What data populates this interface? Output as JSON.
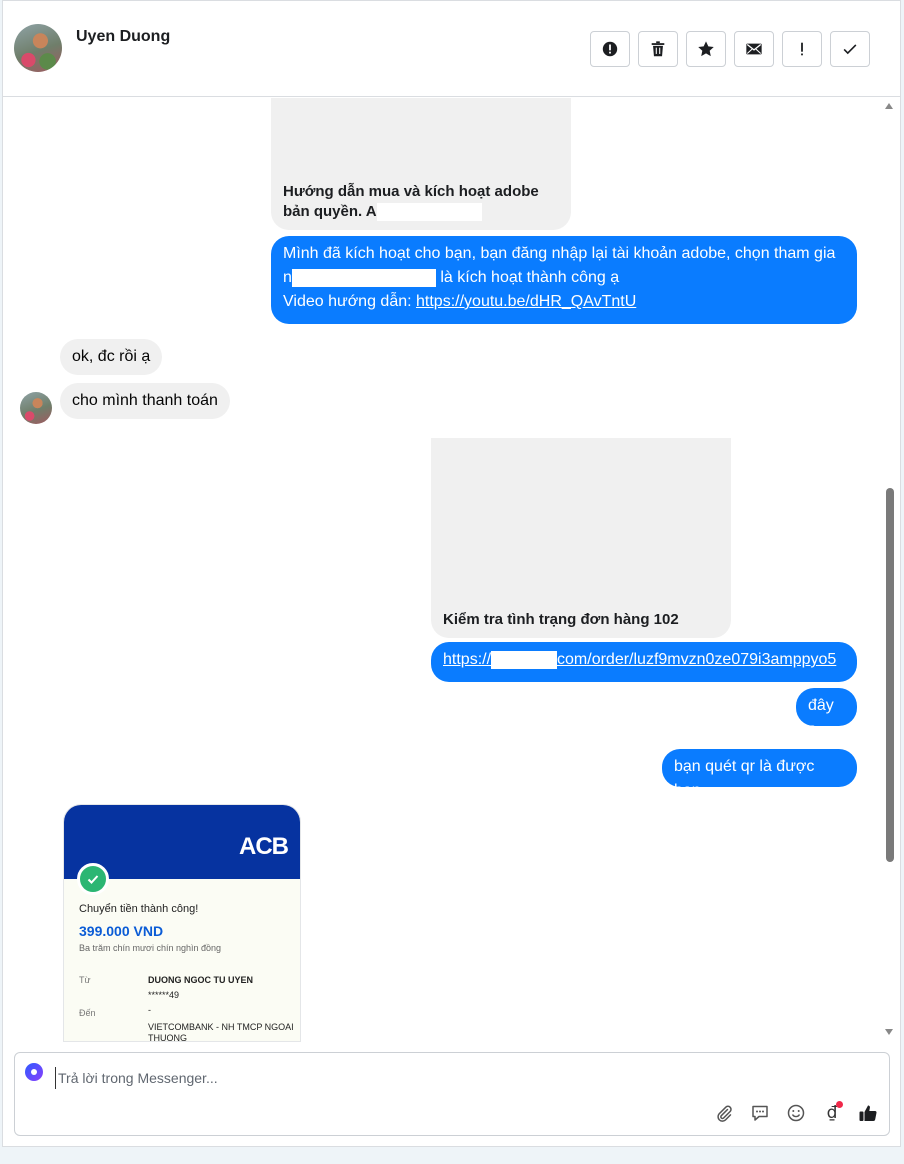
{
  "header": {
    "contact_name": "Uyen Duong",
    "actions": [
      {
        "name": "report-button",
        "icon": "alert-circle-icon"
      },
      {
        "name": "delete-button",
        "icon": "trash-icon"
      },
      {
        "name": "star-button",
        "icon": "star-icon"
      },
      {
        "name": "mark-unread-button",
        "icon": "envelope-icon"
      },
      {
        "name": "important-button",
        "icon": "exclamation-icon"
      },
      {
        "name": "done-button",
        "icon": "check-icon"
      }
    ]
  },
  "messages": {
    "card1_text_line1": "Hướng dẫn mua và kích hoạt adobe",
    "card1_text_line2": "bản quyền. A",
    "out1_line1": "Mình đã kích hoạt cho bạn, bạn đăng nhập lại tài khoản adobe, chọn tham gia",
    "out1_line2_prefix": "n",
    "out1_line2_suffix": " là kích hoạt thành công ạ",
    "out1_line3_label": "Video hướng dẫn: ",
    "out1_line3_link": "https://youtu.be/dHR_QAvTntU",
    "in1": "ok, đc rồi ạ",
    "in2": "cho mình thanh toán",
    "card2_text": "Kiểm tra tình trạng đơn hàng 102",
    "out2_link_prefix": "https://",
    "out2_link_suffix": "com/order/luzf9mvzn0ze079i3amppyo5",
    "out3": "đây ạ",
    "out4": "bạn quét qr là được bạn"
  },
  "receipt": {
    "bank_logo": "ACB",
    "title": "Chuyển tiền thành công!",
    "amount": "399.000 VND",
    "amount_words": "Ba trăm chín mươi chín nghìn đồng",
    "from_label": "Từ",
    "from_name": "DUONG NGOC TU UYEN",
    "from_account": "******49",
    "to_label": "Đến",
    "to_account": "-",
    "to_bank_line1": "VIETCOMBANK - NH TMCP NGOAI",
    "to_bank_line2": "THUONG"
  },
  "composer": {
    "placeholder": "Trả lời trong Messenger...",
    "tools": [
      "paperclip-icon",
      "chat-bubble-icon",
      "smile-icon",
      "dong-currency-icon",
      "thumbs-up-icon"
    ],
    "dong_symbol": "₫"
  },
  "colors": {
    "outgoing_bubble": "#0a7cff",
    "incoming_bubble": "#f0f0f0",
    "acb_blue": "#0633a0",
    "success_green": "#2bb673"
  }
}
